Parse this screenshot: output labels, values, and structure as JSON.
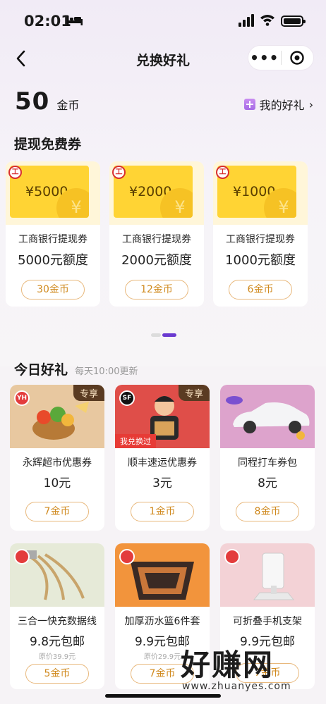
{
  "status": {
    "time": "02:01"
  },
  "nav": {
    "title": "兑换好礼",
    "more": "•••"
  },
  "wallet": {
    "coins": "50",
    "unit": "金币",
    "my_gifts": "我的好礼"
  },
  "sections": {
    "voucher_title": "提现免费券",
    "today_title": "今日好礼",
    "today_sub": "每天10:00更新"
  },
  "vouchers": [
    {
      "bill": "¥5000",
      "name": "工商银行提现券",
      "value": "5000元额度",
      "price": "30金币"
    },
    {
      "bill": "¥2000",
      "name": "工商银行提现券",
      "value": "2000元额度",
      "price": "12金币"
    },
    {
      "bill": "¥1000",
      "name": "工商银行提现券",
      "value": "1000元额度",
      "price": "6金币"
    }
  ],
  "products": [
    {
      "logo": "YH",
      "badge": "专享",
      "name": "永辉超市优惠券",
      "value": "10元",
      "price": "7金币"
    },
    {
      "logo": "SF",
      "badge": "专享",
      "got": "我兑换过",
      "name": "顺丰速运优惠券",
      "value": "3元",
      "price": "1金币"
    },
    {
      "name": "同程打车券包",
      "value": "8元",
      "price": "8金币"
    },
    {
      "name": "三合一快充数据线",
      "value": "9.8元包邮",
      "orig": "原价39.9元",
      "price": "5金币"
    },
    {
      "name": "加厚沥水篮6件套",
      "value": "9.9元包邮",
      "orig": "原价29.9元",
      "price": "7金币"
    },
    {
      "name": "可折叠手机支架",
      "value": "9.9元包邮",
      "price": "7金币"
    }
  ],
  "watermark": {
    "text": "好赚网",
    "url": "www.zhuanyes.com"
  },
  "colors": {
    "accent": "#6a3ad0",
    "coin_text": "#d08a1f",
    "voucher_yellow": "#ffd434"
  }
}
